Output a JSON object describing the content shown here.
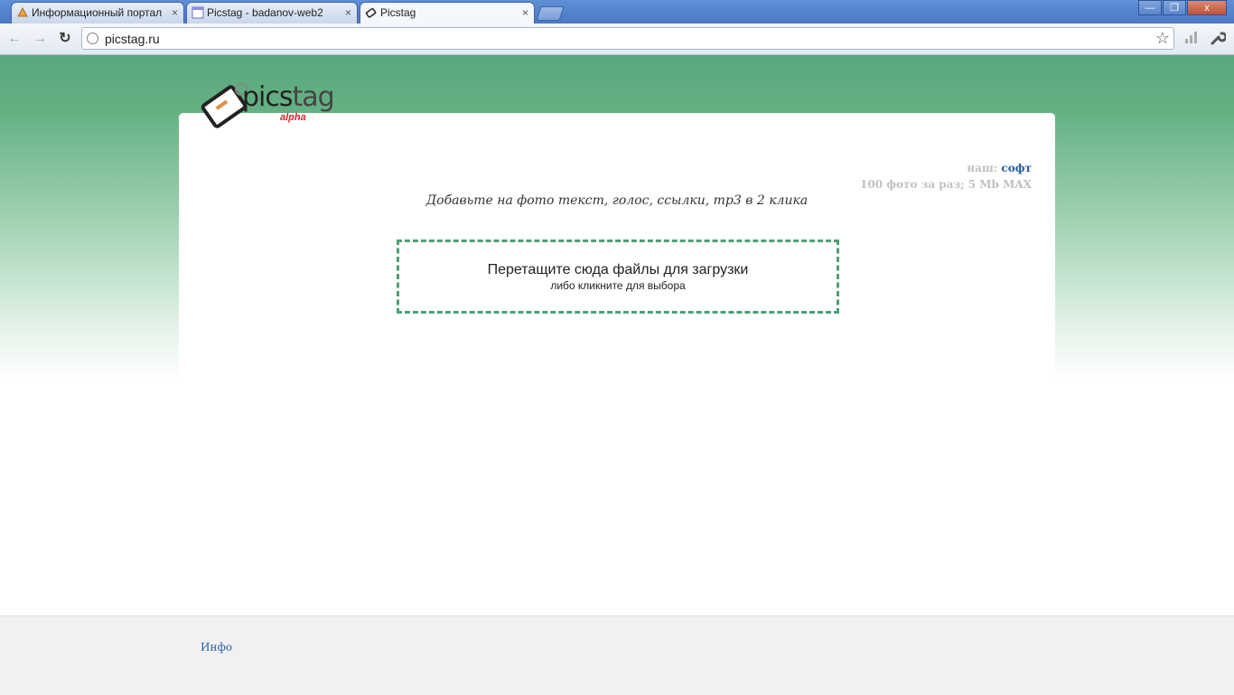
{
  "browser": {
    "tabs": [
      {
        "title": "Информационный портал",
        "active": false
      },
      {
        "title": "Picstag - badanov-web2",
        "active": false
      },
      {
        "title": "Picstag",
        "active": true
      }
    ],
    "tab_close_glyph": "×",
    "url": "picstag.ru",
    "window_buttons": {
      "minimize": "—",
      "restore": "❐",
      "close": "x"
    }
  },
  "page": {
    "logo": {
      "word_a": "pics",
      "word_b": "tag",
      "badge": "alpha"
    },
    "soft_prefix": "наш:",
    "soft_link": "софт",
    "limits": "100 фото за раз; 5 Mb MAX",
    "tagline": "Добавьте на фото текст, голос, ссылки, mp3 в 2 клика",
    "dropzone": {
      "main": "Перетащите сюда файлы для загрузки",
      "sub": "либо кликните для выбора"
    },
    "footer_link": "Инфо"
  },
  "colors": {
    "brand_green": "#58a87c",
    "dash_border": "#4c9f75",
    "link_blue": "#215e9e",
    "alpha_red": "#e0232b"
  }
}
